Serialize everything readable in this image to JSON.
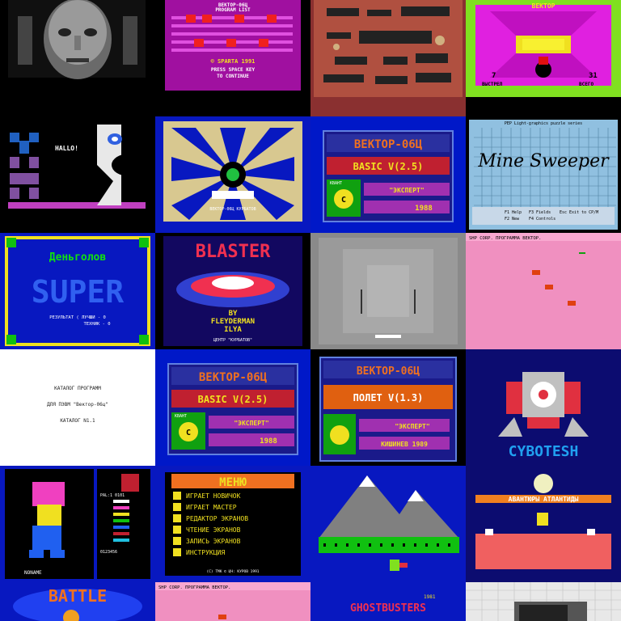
{
  "tiles": {
    "t1": {},
    "t2": {
      "line1": "ВЕКТОР-06Ц",
      "line2": "PROGRAM LIST",
      "line3": "© SPARTA 1991",
      "line4": "PRESS SPACE KEY",
      "line5": "TO CONTINUE"
    },
    "t3": {},
    "t4": {
      "top": "ВЕКТОР",
      "left_label": "ВЫСТРЕЛ",
      "right_label": "ВСЕГО",
      "left_num": "7",
      "right_num": "31"
    },
    "t5": {
      "hello": "HALLO!"
    },
    "t6": {
      "caption": "ВЕКТОР-06Ц\nКУРБАТОВ"
    },
    "t7": {
      "title": "ВЕКТОР-06Ц",
      "basic": "BASIC V(2.5)",
      "brand": "КВАНТ",
      "maker": "\"ЭКСПЕРТ\"",
      "year": "1988"
    },
    "t8": {
      "header": "PEP Light-graphics puzzle series",
      "title": "Mine Sweeper",
      "help": "F1 Help",
      "new": "F2 New",
      "fields": "F3 Fields",
      "controls": "F4 Controls",
      "exit": "Esc Exit to CP/M"
    },
    "t9": {
      "title1": "Деньголов",
      "title2": "SUPER",
      "result": "РЕЗУЛЬТАТ ( ЛУЧШИ - 0",
      "tech": "ТЕХНИК - 0"
    },
    "t10": {
      "title": "BLASTER",
      "by": "BY",
      "author": "FLEYDERMAN",
      "name": "ILYA",
      "footer": "ЦЕНТР \"КУРБАТОВ\""
    },
    "t11": {},
    "t12": {
      "header": "SHP CORP.              ПРОГРАММА ВЕКТОР."
    },
    "t13": {
      "line1": "КАТАЛОГ ПРОГРАММ",
      "line2": "ДЛЯ ПЭВМ \"Вектор-06ц\"",
      "line3": "КАТАЛОГ N1.1"
    },
    "t14": {
      "title": "ВЕКТОР-06Ц",
      "basic": "BASIC V(2.5)",
      "brand": "КВАНТ",
      "maker": "\"ЭКСПЕРТ\"",
      "year": "1988"
    },
    "t15": {
      "title": "ВЕКТОР-06Ц",
      "prog": "ПОЛЕТ V(1.3)",
      "maker": "\"ЭКСПЕРТ\"",
      "year": "КИШИНЕВ 1989"
    },
    "t16": {
      "title": "CYBOTESH"
    },
    "t17": {
      "pal": "PAL:1  0101",
      "num": "0123456",
      "footer": "NONAME"
    },
    "t18": {
      "title": "МЕНЮ",
      "items": [
        "ИГРАЕТ НОВИЧОК",
        "ИГРАЕТ МАСТЕР",
        "РЕДАКТОР ЭКРАНОВ",
        "ЧТЕНИЕ ЭКРАНОВ",
        "ЗАПИСЬ ЭКРАНОВ",
        "ИНСТРУКЦИЯ"
      ],
      "footer": "(C) ТМК  ©  ЦЧ: КУРОВ  1991"
    },
    "t19": {},
    "t20": {
      "banner": "АВАНТЮРЫ АТЛАНТИДЫ"
    },
    "t21": {
      "title": "BATTLE"
    },
    "t22": {
      "header": "SHP CORP.              ПРОГРАММА ВЕКТОР."
    },
    "t23": {
      "title": "GHOSTBUSTERS",
      "num": "1981"
    },
    "t24": {}
  },
  "colors": {
    "vector_blue": "#0018c8",
    "magenta": "#a010a0",
    "pink": "#f090c0",
    "yellow": "#f0e020",
    "green": "#10c010"
  }
}
